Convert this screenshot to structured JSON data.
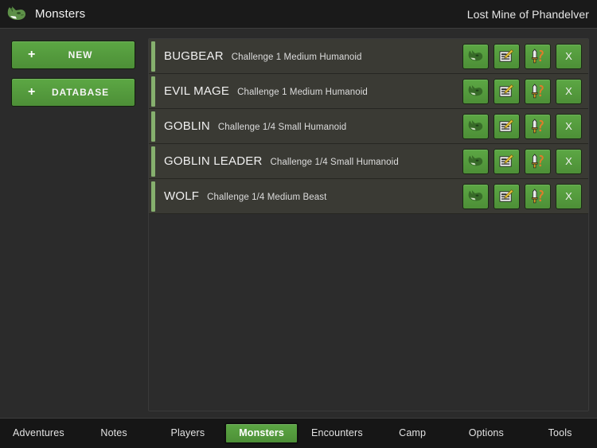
{
  "header": {
    "logo_icon": "goblin-head-icon",
    "title": "Monsters",
    "campaign": "Lost Mine of Phandelver"
  },
  "sidebar": {
    "buttons": [
      {
        "icon": "plus-icon",
        "plus": "+",
        "label": "NEW"
      },
      {
        "icon": "plus-icon",
        "plus": "+",
        "label": "DATABASE"
      }
    ]
  },
  "main": {
    "action_labels": {
      "view": "view-monster-icon",
      "edit": "edit-document-icon",
      "combat": "weapon-icon",
      "delete": "X"
    },
    "monsters": [
      {
        "name": "BUGBEAR",
        "meta": "Challenge 1 Medium Humanoid"
      },
      {
        "name": "EVIL MAGE",
        "meta": "Challenge 1 Medium Humanoid"
      },
      {
        "name": "GOBLIN",
        "meta": "Challenge 1/4 Small Humanoid"
      },
      {
        "name": "GOBLIN LEADER",
        "meta": "Challenge 1/4 Small Humanoid"
      },
      {
        "name": "WOLF",
        "meta": "Challenge 1/4 Medium Beast"
      }
    ]
  },
  "bottom_nav": {
    "items": [
      {
        "label": "Adventures",
        "active": false
      },
      {
        "label": "Notes",
        "active": false
      },
      {
        "label": "Players",
        "active": false
      },
      {
        "label": "Monsters",
        "active": true
      },
      {
        "label": "Encounters",
        "active": false
      },
      {
        "label": "Camp",
        "active": false
      },
      {
        "label": "Options",
        "active": false
      },
      {
        "label": "Tools",
        "active": false
      }
    ]
  },
  "colors": {
    "accent_green": "#4d8f37",
    "row_accent": "#86b06e",
    "row_bg": "#3a3a34",
    "panel_bg": "#2c2c2c",
    "app_bg": "#2b2b2b",
    "header_bg": "#1a1a1a",
    "nav_bg": "#161616"
  }
}
